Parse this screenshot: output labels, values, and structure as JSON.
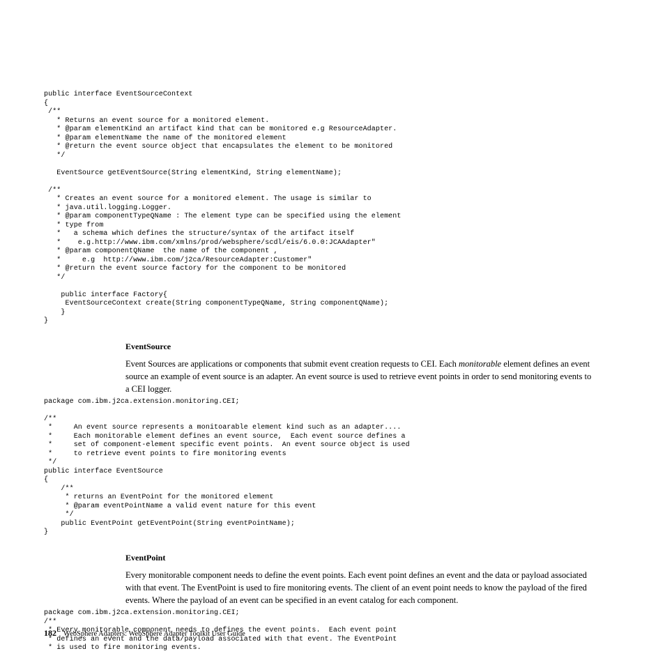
{
  "code_block_1": "public interface EventSourceContext\n{\n /**\n   * Returns an event source for a monitored element.\n   * @param elementKind an artifact kind that can be monitored e.g ResourceAdapter.\n   * @param elementName the name of the monitored element\n   * @return the event source object that encapsulates the element to be monitored\n   */\n\n   EventSource getEventSource(String elementKind, String elementName);\n\n /**\n   * Creates an event source for a monitored element. The usage is similar to\n   * java.util.logging.Logger.\n   * @param componentTypeQName : The element type can be specified using the element\n   * type from\n   *   a schema which defines the structure/syntax of the artifact itself\n   *    e.g.http://www.ibm.com/xmlns/prod/websphere/scdl/eis/6.0.0:JCAAdapter\"\n   * @param componentQName  the name of the component ,\n   *     e.g  http://www.ibm.com/j2ca/ResourceAdapter:Customer\"\n   * @return the event source factory for the component to be monitored\n   */\n\n    public interface Factory{\n     EventSourceContext create(String componentTypeQName, String componentQName);\n    }\n}",
  "heading_1": "EventSource",
  "paragraph_1_a": "Event Sources are applications or components that submit event creation requests to CEI. Each ",
  "paragraph_1_italic": "monitorable",
  "paragraph_1_b": " element defines an event source an example of event source is an adapter. An event source is used to retrieve event points in order to send monitoring events to a CEI logger.",
  "code_block_2": "package com.ibm.j2ca.extension.monitoring.CEI;\n\n/**\n *     An event source represents a monitoarable element kind such as an adapter....\n *     Each monitorable element defines an event source,  Each event source defines a\n *     set of component-element specific event points.  An event source object is used\n *     to retrieve event points to fire monitoring events\n */\npublic interface EventSource\n{\n    /**\n     * returns an EventPoint for the monitored element\n     * @param eventPointName a valid event nature for this event\n     */\n    public EventPoint getEventPoint(String eventPointName);\n}",
  "heading_2": "EventPoint",
  "paragraph_2": "Every monitorable component needs to define the event points. Each event point defines an event and the data or payload associated with that event. The EventPoint is used to fire monitoring events. The client of an event point needs to know the payload of the fired events. Where the payload of an event can be specified in an event catalog for each component.",
  "code_block_3": "package com.ibm.j2ca.extension.monitoring.CEI;\n/**\n * Every monitorable component needs to defines the event points.  Each event point\n * defines an event and the data/payload associated with that event. The EventPoint\n * is used to fire monitoring events.",
  "page_number": "182",
  "footer_text": "WebSphere Adapters:  WebSphere Adapter Toolkit User Guide"
}
